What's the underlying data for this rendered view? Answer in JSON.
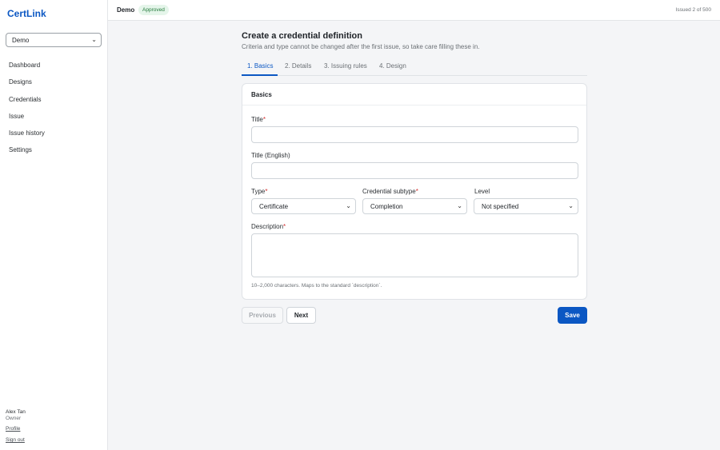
{
  "app": {
    "brand": "CertLink"
  },
  "sidebar": {
    "org_select": {
      "value": "Demo"
    },
    "items": [
      {
        "label": "Dashboard"
      },
      {
        "label": "Designs"
      },
      {
        "label": "Credentials"
      },
      {
        "label": "Issue"
      },
      {
        "label": "Issue history"
      },
      {
        "label": "Settings"
      }
    ],
    "user": {
      "name": "Alex Tan",
      "role": "Owner",
      "profile_link": "Profile",
      "signout_link": "Sign out"
    }
  },
  "topbar": {
    "org_name": "Demo",
    "status_badge": "Approved",
    "issued_count": "Issued 2 of 500"
  },
  "page": {
    "title": "Create a credential definition",
    "subtitle": "Criteria and type cannot be changed after the first issue, so take care filling these in."
  },
  "tabs": [
    {
      "label": "1. Basics",
      "active": true
    },
    {
      "label": "2. Details"
    },
    {
      "label": "3. Issuing rules"
    },
    {
      "label": "4. Design"
    }
  ],
  "card": {
    "title": "Basics",
    "fields": {
      "title": {
        "label": "Title",
        "required_mark": "*",
        "value": ""
      },
      "title_en": {
        "label": "Title (English)",
        "value": ""
      },
      "type": {
        "label": "Type",
        "required_mark": "*",
        "value": "Certificate"
      },
      "subtype": {
        "label": "Credential subtype",
        "required_mark": "*",
        "value": "Completion"
      },
      "level": {
        "label": "Level",
        "value": "Not specified"
      },
      "description": {
        "label": "Description",
        "required_mark": "*",
        "value": "",
        "help": "10–2,000 characters. Maps to the standard `description`."
      }
    }
  },
  "actions": {
    "previous": "Previous",
    "next": "Next",
    "save": "Save"
  },
  "colors": {
    "accent": "#0b57c3",
    "badge_bg": "#e5f5ea",
    "badge_text": "#237a3b",
    "required": "#d32f2f"
  }
}
